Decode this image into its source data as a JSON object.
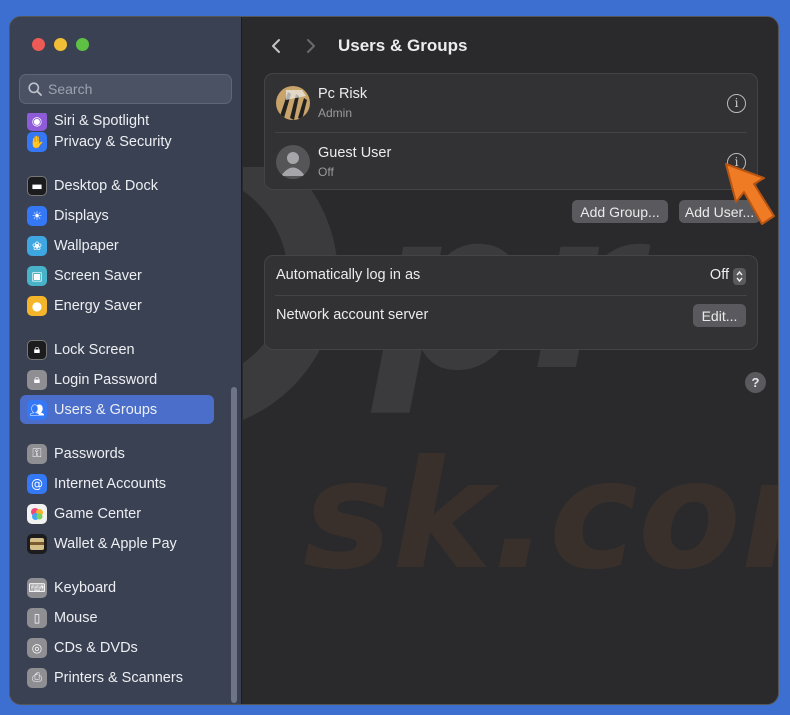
{
  "window": {
    "title": "Users & Groups"
  },
  "sidebar": {
    "search_placeholder": "Search",
    "items": [
      {
        "label": "Siri & Spotlight",
        "icon": "siri-icon",
        "color": "#8e5cd9"
      },
      {
        "label": "Privacy & Security",
        "icon": "hand-icon",
        "color": "#3478f6"
      },
      {
        "label": "Desktop & Dock",
        "icon": "dock-icon",
        "color": "#1c1c1e"
      },
      {
        "label": "Displays",
        "icon": "sun-icon",
        "color": "#3478f6"
      },
      {
        "label": "Wallpaper",
        "icon": "flower-icon",
        "color": "#3ea6e0"
      },
      {
        "label": "Screen Saver",
        "icon": "screensaver-icon",
        "color": "#48b2c9"
      },
      {
        "label": "Energy Saver",
        "icon": "bulb-icon",
        "color": "#f5b52a"
      },
      {
        "label": "Lock Screen",
        "icon": "lock-icon",
        "color": "#1c1c1e"
      },
      {
        "label": "Login Password",
        "icon": "lock-icon",
        "color": "#8e8e93"
      },
      {
        "label": "Users & Groups",
        "icon": "users-icon",
        "color": "#3478f6"
      },
      {
        "label": "Passwords",
        "icon": "key-icon",
        "color": "#8e8e93"
      },
      {
        "label": "Internet Accounts",
        "icon": "at-icon",
        "color": "#3478f6"
      },
      {
        "label": "Game Center",
        "icon": "gamecenter-icon",
        "color": "#f2f2f2"
      },
      {
        "label": "Wallet & Apple Pay",
        "icon": "wallet-icon",
        "color": "#1c1c1e"
      },
      {
        "label": "Keyboard",
        "icon": "keyboard-icon",
        "color": "#8e8e93"
      },
      {
        "label": "Mouse",
        "icon": "mouse-icon",
        "color": "#8e8e93"
      },
      {
        "label": "CDs & DVDs",
        "icon": "disc-icon",
        "color": "#8e8e93"
      },
      {
        "label": "Printers & Scanners",
        "icon": "printer-icon",
        "color": "#8e8e93"
      }
    ],
    "active_item": "Users & Groups"
  },
  "users": [
    {
      "name": "Pc Risk",
      "role": "Admin",
      "avatar": "zebra-avatar"
    },
    {
      "name": "Guest User",
      "role": "Off",
      "avatar": "generic-avatar"
    }
  ],
  "buttons": {
    "add_group": "Add Group...",
    "add_user": "Add User..."
  },
  "settings": {
    "auto_login_label": "Automatically log in as",
    "auto_login_value": "Off",
    "network_server_label": "Network account server",
    "edit_button": "Edit..."
  },
  "help": "?",
  "colors": {
    "accent": "#4a6ec9",
    "arrow": "#f07b25"
  }
}
